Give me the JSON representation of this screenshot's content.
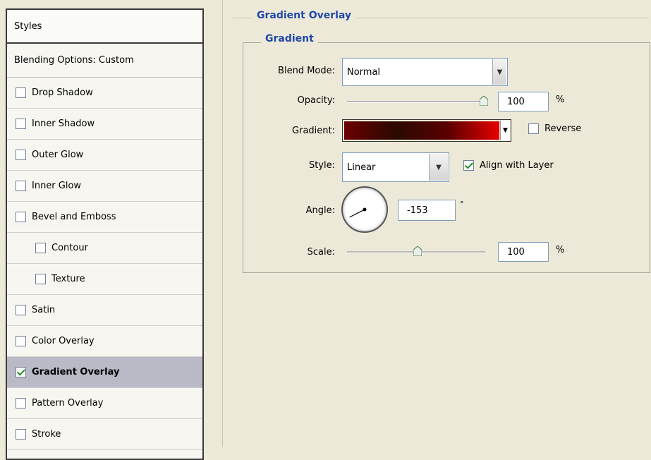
{
  "left_panel": {
    "header": "Styles",
    "blending_options": "Blending Options: Custom",
    "items": [
      {
        "label": "Drop Shadow",
        "checked": false
      },
      {
        "label": "Inner Shadow",
        "checked": false
      },
      {
        "label": "Outer Glow",
        "checked": false
      },
      {
        "label": "Inner Glow",
        "checked": false
      },
      {
        "label": "Bevel and Emboss",
        "checked": false
      },
      {
        "label": "Contour",
        "checked": false
      },
      {
        "label": "Texture",
        "checked": false
      },
      {
        "label": "Satin",
        "checked": false
      },
      {
        "label": "Color Overlay",
        "checked": false
      },
      {
        "label": "Gradient Overlay",
        "checked": true,
        "selected": true
      },
      {
        "label": "Pattern Overlay",
        "checked": false
      },
      {
        "label": "Stroke",
        "checked": false
      }
    ]
  },
  "panel": {
    "section_title": "Gradient Overlay",
    "group_title": "Gradient",
    "blend_mode_label": "Blend Mode:",
    "blend_mode_value": "Normal",
    "opacity_label": "Opacity:",
    "opacity_value": "100",
    "opacity_unit": "%",
    "opacity_level": 1.0,
    "gradient_label": "Gradient:",
    "gradient_colors": [
      "#6b0000",
      "#2a0a00",
      "#5a0000",
      "#e60000"
    ],
    "reverse_label": "Reverse",
    "reverse_checked": false,
    "style_label": "Style:",
    "style_value": "Linear",
    "align_label": "Align with Layer",
    "align_checked": true,
    "angle_label": "Angle:",
    "angle_value": "-153",
    "angle_unit": "°",
    "scale_label": "Scale:",
    "scale_value": "100",
    "scale_unit": "%",
    "scale_level": 0.5
  }
}
